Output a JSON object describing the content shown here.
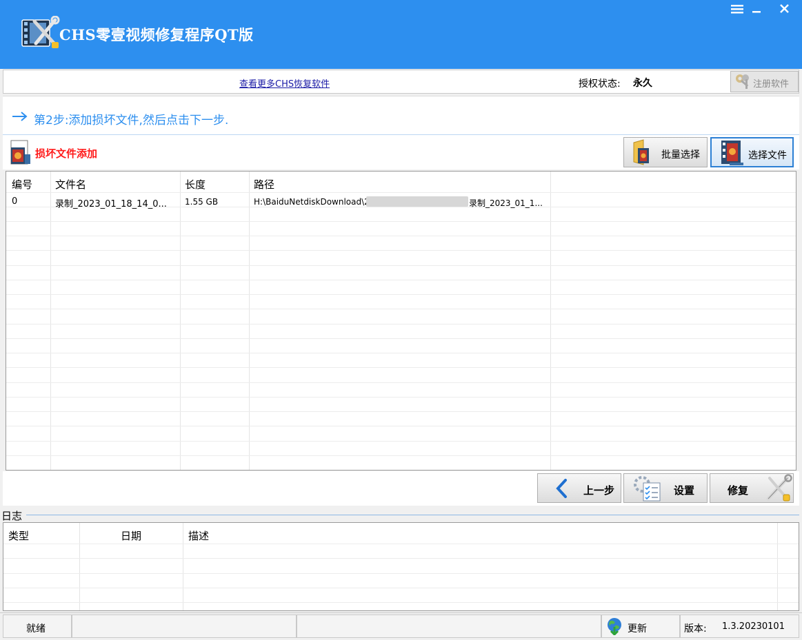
{
  "window": {
    "title": "CHS零壹视频修复程序QT版"
  },
  "infobar": {
    "more_link": "查看更多CHS恢复软件",
    "auth_label": "授权状态:",
    "auth_value": "永久",
    "register_button": "注册软件"
  },
  "step": {
    "text": "第2步:添加损坏文件,然后点击下一步."
  },
  "add_panel": {
    "title": "损坏文件添加",
    "batch_select": "批量选择",
    "select_file": "选择文件"
  },
  "file_table": {
    "columns": [
      "编号",
      "文件名",
      "长度",
      "路径"
    ],
    "rows": [
      {
        "id": "0",
        "name": "录制_2023_01_18_14_0...",
        "size": "1.55 GB",
        "path_prefix": "H:\\BaiduNetdiskDownload\\2",
        "path_suffix": "录制_2023_01_1..."
      }
    ]
  },
  "actions": {
    "prev": "上一步",
    "settings": "设置",
    "repair": "修复"
  },
  "log": {
    "title": "日志",
    "columns": [
      "类型",
      "日期",
      "描述"
    ]
  },
  "statusbar": {
    "status": "就绪",
    "update": "更新",
    "version_label": "版本:",
    "version_value": "1.3.20230101"
  },
  "colors": {
    "titlebar": "#2d8fef",
    "step_text": "#2d8fef",
    "add_title": "#ff1a1a",
    "link": "#1a1aa6"
  },
  "icons": {
    "app": "video-repair-logo-icon",
    "menu": "hamburger-menu-icon",
    "minimize": "minimize-icon",
    "close": "close-icon",
    "register": "keys-icon",
    "step": "arrow-right-icon",
    "add": "film-file-icon",
    "batch": "folder-film-icon",
    "select": "film-icon",
    "prev": "chevron-left-icon",
    "settings": "checklist-gear-icon",
    "repair": "wrench-screwdriver-icon",
    "update": "globe-update-icon"
  }
}
